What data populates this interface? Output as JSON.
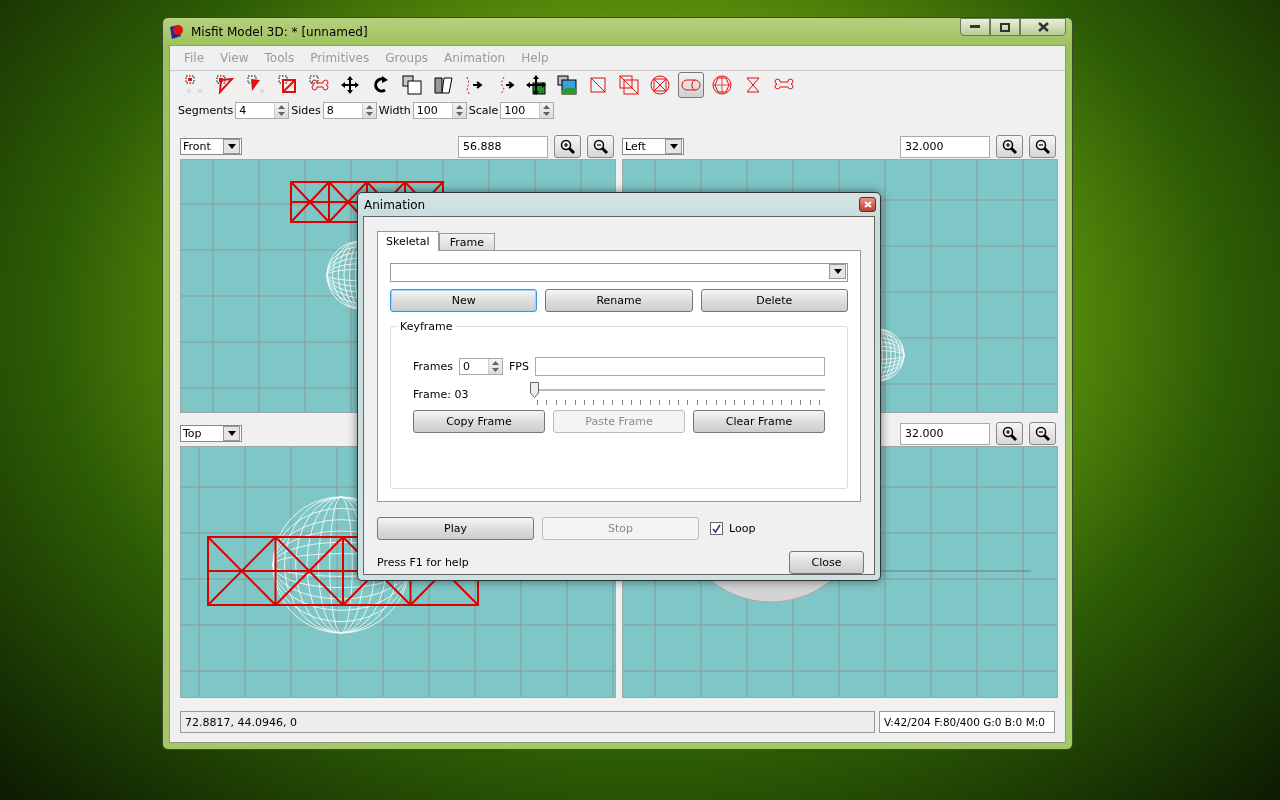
{
  "window": {
    "title": "Misfit Model 3D: * [unnamed]"
  },
  "menu": [
    {
      "label": "File",
      "disabled": true
    },
    {
      "label": "View",
      "disabled": true
    },
    {
      "label": "Tools",
      "disabled": true
    },
    {
      "label": "Primitives",
      "disabled": true
    },
    {
      "label": "Groups",
      "disabled": true
    },
    {
      "label": "Animation",
      "disabled": true
    },
    {
      "label": "Help",
      "disabled": true
    }
  ],
  "toolbar": {
    "tools": [
      {
        "selected": false
      },
      {
        "selected": false
      },
      {
        "selected": false
      },
      {
        "selected": false
      },
      {
        "selected": false
      },
      {
        "selected": false
      },
      {
        "selected": false
      },
      {
        "selected": false
      },
      {
        "selected": false
      },
      {
        "selected": false
      },
      {
        "selected": false
      },
      {
        "selected": false
      },
      {
        "selected": false
      },
      {
        "selected": false
      },
      {
        "selected": false
      },
      {
        "selected": false
      },
      {
        "selected": true
      },
      {
        "selected": false
      },
      {
        "selected": false
      },
      {
        "selected": false
      }
    ]
  },
  "params": [
    {
      "label": "Segments",
      "value": "4"
    },
    {
      "label": "Sides",
      "value": "8"
    },
    {
      "label": "Width",
      "value": "100"
    },
    {
      "label": "Scale",
      "value": "100"
    }
  ],
  "viewports": [
    {
      "view": "Front",
      "zoom": "56.888",
      "kind": "front"
    },
    {
      "view": "Left",
      "zoom": "32.000",
      "kind": "left"
    },
    {
      "view": "Top",
      "kind": "top"
    },
    {
      "zoom": "32.000",
      "kind": "shaded"
    }
  ],
  "status_bar": {
    "coordinates": "72.8817, 44.0946, 0",
    "counts": "V:42/204 F:80/400 G:0 B:0 M:0"
  },
  "dialog": {
    "title": "Animation",
    "tabs": [
      {
        "label": "Skeletal",
        "selected": true
      },
      {
        "label": "Frame",
        "selected": false
      }
    ],
    "buttons": [
      {
        "label": "New",
        "focused": true
      },
      {
        "label": "Rename",
        "focused": false
      },
      {
        "label": "Delete",
        "focused": false
      }
    ],
    "keyframe": {
      "title": "Keyframe",
      "frames_label": "Frames",
      "frames_value": "0",
      "fps_label": "FPS",
      "frame_label": "Frame: 03",
      "level": 0,
      "buttons": [
        {
          "label": "Copy Frame",
          "disabled": false
        },
        {
          "label": "Paste Frame",
          "disabled": true
        },
        {
          "label": "Clear Frame",
          "disabled": false
        }
      ]
    },
    "playback": [
      {
        "label": "Play",
        "disabled": false
      },
      {
        "label": "Stop",
        "disabled": true
      }
    ],
    "loop": {
      "label": "Loop",
      "checked": true
    },
    "help": "Press F1 for help",
    "close": "Close"
  }
}
